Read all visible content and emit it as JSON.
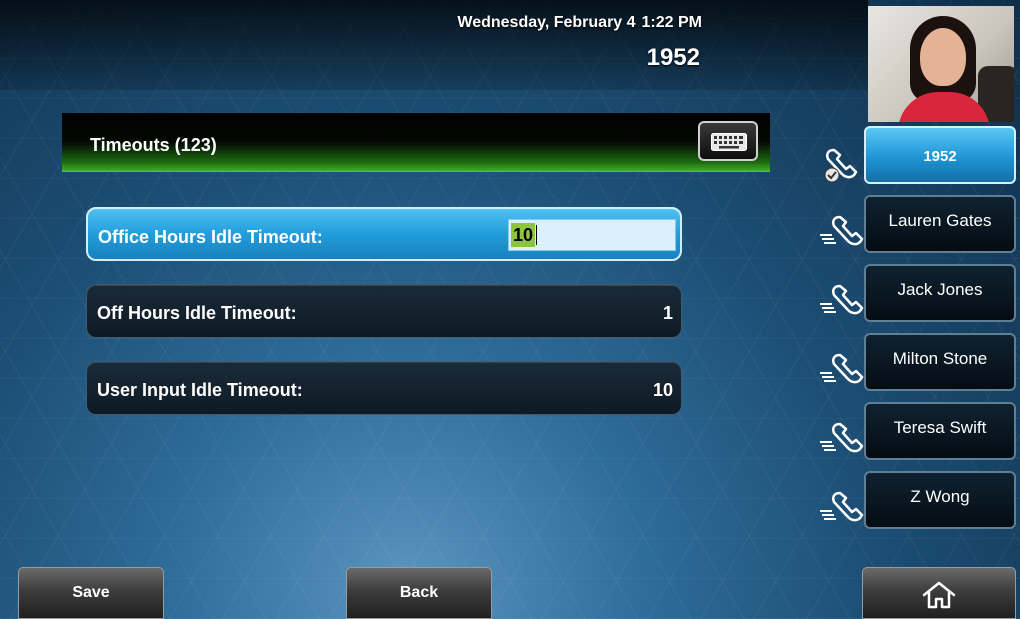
{
  "header": {
    "date": "Wednesday, February 4",
    "time": "1:22 PM",
    "extension": "1952"
  },
  "panel": {
    "title": "Timeouts (123)",
    "keyboard_icon": "keyboard-icon"
  },
  "settings": [
    {
      "label": "Office Hours Idle Timeout:",
      "value": "10",
      "selected": true
    },
    {
      "label": "Off Hours Idle Timeout:",
      "value": "1",
      "selected": false
    },
    {
      "label": "User Input Idle Timeout:",
      "value": "10",
      "selected": false
    }
  ],
  "lines": [
    {
      "label": "1952",
      "icon": "phone-registered-icon",
      "active": true
    },
    {
      "label": "Lauren Gates",
      "icon": "phone-speed-dial-icon",
      "active": false
    },
    {
      "label": "Jack Jones",
      "icon": "phone-speed-dial-icon",
      "active": false
    },
    {
      "label": "Milton Stone",
      "icon": "phone-speed-dial-icon",
      "active": false
    },
    {
      "label": "Teresa Swift",
      "icon": "phone-speed-dial-icon",
      "active": false
    },
    {
      "label": "Z Wong",
      "icon": "phone-speed-dial-icon",
      "active": false
    }
  ],
  "softkeys": {
    "save": "Save",
    "back": "Back",
    "home_icon": "home-icon"
  },
  "colors": {
    "selected_row": "#229ddc",
    "title_bar_green": "#3fae24",
    "input_highlight": "#8cc63f"
  }
}
